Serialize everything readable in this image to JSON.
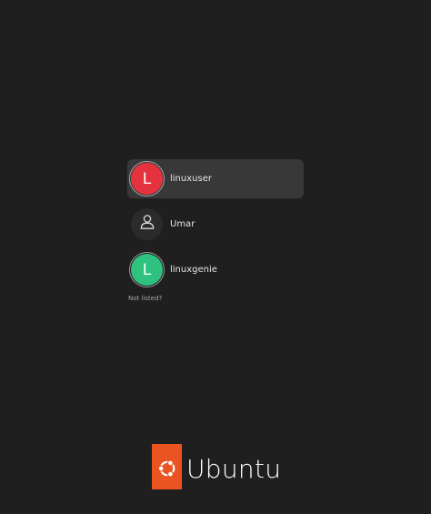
{
  "users": [
    {
      "name": "linuxuser",
      "initial": "L",
      "color": "#e5323f",
      "selected": true
    },
    {
      "name": "Umar",
      "icon": "user-icon",
      "selected": false
    },
    {
      "name": "linuxgenie",
      "initial": "L",
      "color": "#2ec27e",
      "selected": false
    }
  ],
  "not_listed_label": "Not listed?",
  "brand": {
    "name": "Ubuntu",
    "logo_icon": "circle-of-friends-icon",
    "accent": "#e95420"
  },
  "background_color": "#1f1f1f"
}
